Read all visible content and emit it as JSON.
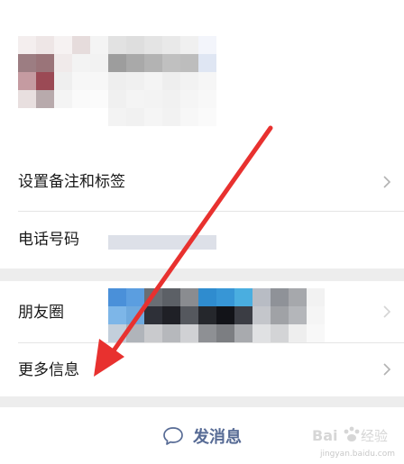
{
  "rows": {
    "remark": {
      "label": "设置备注和标签"
    },
    "phone": {
      "label": "电话号码"
    },
    "moments": {
      "label": "朋友圈"
    },
    "more": {
      "label": "更多信息"
    }
  },
  "actions": {
    "send_message": {
      "label": "发消息",
      "icon": "chat-bubble-icon"
    }
  },
  "colors": {
    "link_blue": "#576b95",
    "arrow_red": "#e8312f",
    "background": "#ededed"
  },
  "watermark": {
    "text": "Bai 经验",
    "url": "jingyan.baidu.com"
  }
}
